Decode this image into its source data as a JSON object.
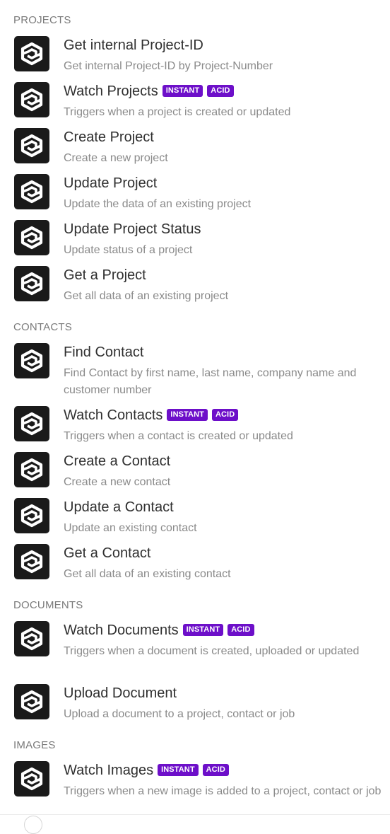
{
  "sections": [
    {
      "title": "PROJECTS",
      "modules": [
        {
          "name": "Get internal Project-ID",
          "description": "Get internal Project-ID by Project-Number",
          "badges": [],
          "icon": "app-logo-icon"
        },
        {
          "name": "Watch Projects",
          "description": "Triggers when a project is created or updated",
          "badges": [
            "INSTANT",
            "ACID"
          ],
          "icon": "app-logo-icon"
        },
        {
          "name": "Create Project",
          "description": "Create a new project",
          "badges": [],
          "icon": "app-logo-icon"
        },
        {
          "name": "Update Project",
          "description": "Update the data of an existing project",
          "badges": [],
          "icon": "app-logo-icon"
        },
        {
          "name": "Update Project Status",
          "description": "Update status of a project",
          "badges": [],
          "icon": "app-logo-icon"
        },
        {
          "name": "Get a Project",
          "description": "Get all data of an existing project",
          "badges": [],
          "icon": "app-logo-icon"
        }
      ]
    },
    {
      "title": "CONTACTS",
      "modules": [
        {
          "name": "Find Contact",
          "description": "Find Contact by first name, last name, company name and customer number",
          "badges": [],
          "icon": "app-logo-icon"
        },
        {
          "name": "Watch Contacts",
          "description": "Triggers when a contact is created or updated",
          "badges": [
            "INSTANT",
            "ACID"
          ],
          "icon": "app-logo-icon"
        },
        {
          "name": "Create a Contact",
          "description": "Create a new contact",
          "badges": [],
          "icon": "app-logo-icon"
        },
        {
          "name": "Update a Contact",
          "description": "Update an existing contact",
          "badges": [],
          "icon": "app-logo-icon"
        },
        {
          "name": "Get a Contact",
          "description": "Get all data of an existing contact",
          "badges": [],
          "icon": "app-logo-icon"
        }
      ]
    },
    {
      "title": "DOCUMENTS",
      "modules": [
        {
          "name": "Watch Documents",
          "description": "Triggers when a document is created, uploaded or updated",
          "badges": [
            "INSTANT",
            "ACID"
          ],
          "icon": "app-logo-icon"
        },
        {
          "name": "Upload Document",
          "description": "Upload a document to a project, contact or job",
          "badges": [],
          "icon": "app-logo-icon"
        }
      ]
    },
    {
      "title": "IMAGES",
      "modules": [
        {
          "name": "Watch Images",
          "description": "Triggers when a new image is added to a project, contact or job",
          "badges": [
            "INSTANT",
            "ACID"
          ],
          "icon": "app-logo-icon"
        }
      ]
    }
  ],
  "colors": {
    "badge_background": "#6d0fc9",
    "icon_background": "#1a1a1a",
    "section_title": "#7a7a7a",
    "module_name": "#2f2f2f",
    "module_description": "#8a8a8a"
  }
}
